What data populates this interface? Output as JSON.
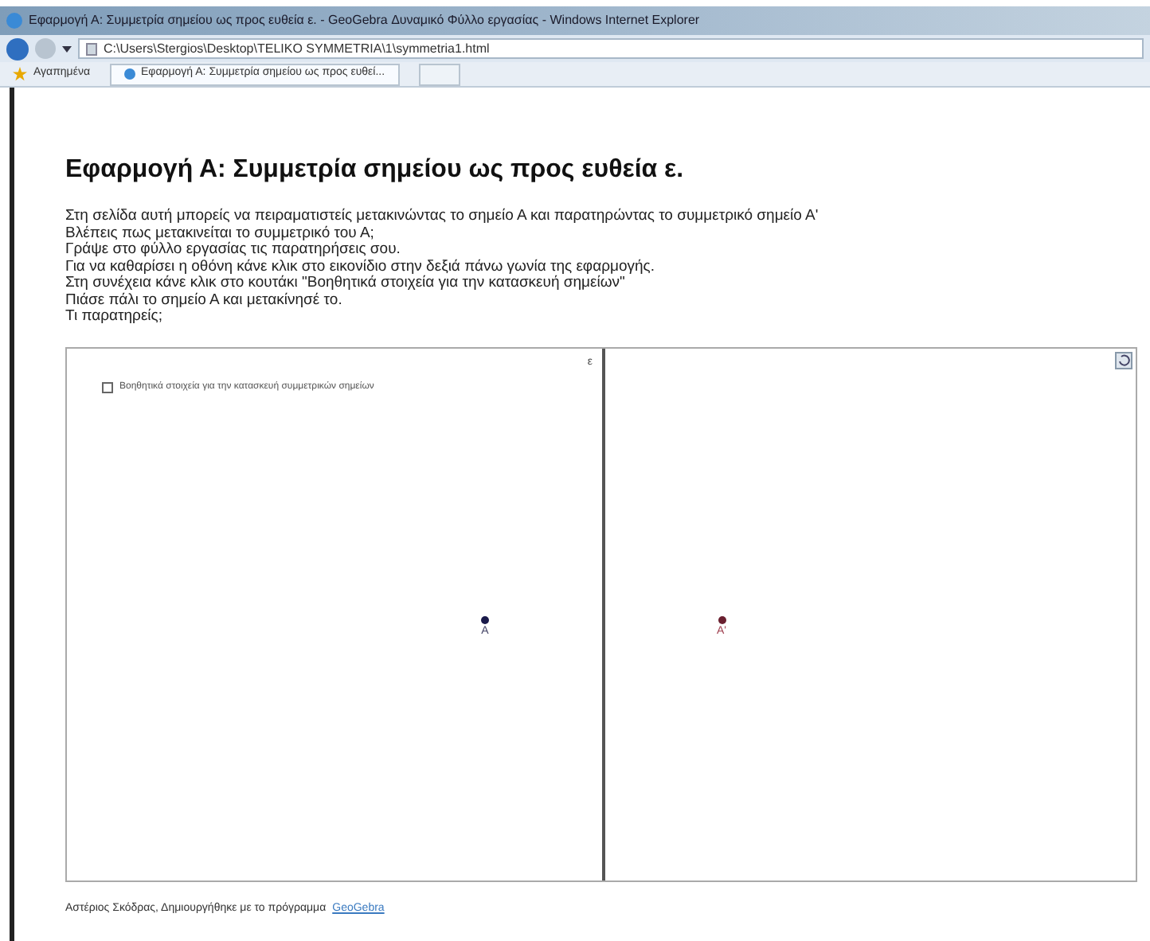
{
  "window": {
    "title": "Εφαρμογή Α: Συμμετρία σημείου ως προς ευθεία ε. - GeoGebra Δυναμικό Φύλλο εργασίας - Windows Internet Explorer"
  },
  "address_bar": {
    "value": "C:\\Users\\Stergios\\Desktop\\TELIKO SYMMETRIA\\1\\symmetria1.html"
  },
  "favorites_bar": {
    "favorites": "Αγαπημένα",
    "tabs": [
      {
        "label": "Εφαρμογή Α: Συμμετρία σημείου ως προς ευθεί...",
        "selected": true
      }
    ]
  },
  "page": {
    "heading": "Εφαρμογή Α: Συμμετρία σημείου ως προς ευθεία ε.",
    "lines": [
      "Στη σελίδα αυτή μπορείς να πειραματιστείς μετακινώντας το σημείο Α και παρατηρώντας το συμμετρικό σημείο Α'",
      "Βλέπεις πως μετακινείται το συμμετρικό του Α;",
      "Γράψε στο φύλλο εργασίας τις παρατηρήσεις σου.",
      "Για να καθαρίσει η οθόνη κάνε κλικ στο εικονίδιο στην δεξιά πάνω γωνία της εφαρμογής.",
      "Στη συνέχεια κάνε κλικ στο κουτάκι \"Βοηθητικά στοιχεία για την κατασκευή σημείων\"",
      "Πιάσε πάλι το σημείο Α και μετακίνησέ το.",
      "Τι παρατηρείς;"
    ]
  },
  "applet": {
    "checkbox": {
      "label": "Βοηθητικά στοιχεία για την κατασκευή συμμετρικών σημείων",
      "checked": false
    },
    "line_label": "ε",
    "points": [
      {
        "label": "A",
        "color": "#1a1a4a"
      },
      {
        "label": "A'",
        "color": "#6a2030"
      }
    ]
  },
  "footer": {
    "text": "Αστέριος Σκόδρας, Δημιουργήθηκε με το πρόγραμμα",
    "link": "GeoGebra"
  }
}
